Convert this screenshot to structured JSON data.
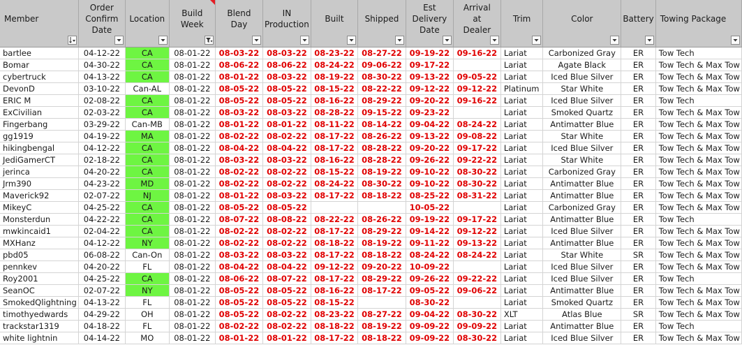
{
  "colors": {
    "header_bg": "#c9c9c9",
    "highlight_green": "#6ef542",
    "date_red": "#e00000",
    "corner_marker": "#e51c23"
  },
  "headers": [
    {
      "key": "member",
      "label": "Member",
      "filter": "sort-icon"
    },
    {
      "key": "order_confirm",
      "label": "Order\nConfirm\nDate",
      "filter": "dropdown-icon"
    },
    {
      "key": "location",
      "label": "Location",
      "filter": "dropdown-icon"
    },
    {
      "key": "build_week",
      "label": "Build\nWeek",
      "filter": "filter-applied-icon"
    },
    {
      "key": "blend_day",
      "label": "Blend\nDay",
      "filter": "dropdown-icon"
    },
    {
      "key": "in_production",
      "label": "IN\nProduction",
      "filter": "dropdown-icon"
    },
    {
      "key": "built",
      "label": "Built",
      "filter": "dropdown-icon"
    },
    {
      "key": "shipped",
      "label": "Shipped",
      "filter": "dropdown-icon"
    },
    {
      "key": "est_delivery",
      "label": "Est\nDelivery\nDate",
      "filter": "dropdown-icon"
    },
    {
      "key": "arrival",
      "label": "Arrival\nat\nDealer",
      "filter": "dropdown-icon"
    },
    {
      "key": "trim",
      "label": "Trim",
      "filter": "dropdown-icon"
    },
    {
      "key": "color",
      "label": "Color",
      "filter": "dropdown-icon"
    },
    {
      "key": "battery",
      "label": "Battery",
      "filter": "dropdown-icon"
    },
    {
      "key": "towing",
      "label": "Towing Package",
      "filter": "dropdown-icon"
    }
  ],
  "rows": [
    {
      "member": "bartlee",
      "order_confirm": "04-12-22",
      "location": "CA",
      "location_green": true,
      "build_week": "08-01-22",
      "blend_day": "08-03-22",
      "in_production": "08-03-22",
      "built": "08-23-22",
      "shipped": "08-27-22",
      "est_delivery": "09-19-22",
      "arrival": "09-16-22",
      "trim": "Lariat",
      "color": "Carbonized Gray",
      "battery": "ER",
      "towing": "Tow Tech"
    },
    {
      "member": "Bomar",
      "order_confirm": "04-30-22",
      "location": "CA",
      "location_green": true,
      "build_week": "08-01-22",
      "blend_day": "08-06-22",
      "in_production": "08-06-22",
      "built": "08-24-22",
      "shipped": "09-06-22",
      "est_delivery": "09-17-22",
      "arrival": "",
      "trim": "Lariat",
      "color": "Agate Black",
      "battery": "ER",
      "towing": "Tow Tech & Max Tow"
    },
    {
      "member": "cybertruck",
      "order_confirm": "04-13-22",
      "location": "CA",
      "location_green": true,
      "build_week": "08-01-22",
      "blend_day": "08-01-22",
      "in_production": "08-03-22",
      "built": "08-19-22",
      "shipped": "08-30-22",
      "est_delivery": "09-13-22",
      "arrival": "09-05-22",
      "trim": "Lariat",
      "color": "Iced Blue Silver",
      "battery": "ER",
      "towing": "Tow Tech & Max Tow"
    },
    {
      "member": "DevonD",
      "order_confirm": "03-10-22",
      "location": "Can-AL",
      "location_green": false,
      "build_week": "08-01-22",
      "blend_day": "08-05-22",
      "in_production": "08-05-22",
      "built": "08-15-22",
      "shipped": "08-22-22",
      "est_delivery": "09-12-22",
      "arrival": "09-12-22",
      "trim": "Platinum",
      "color": "Star White",
      "battery": "ER",
      "towing": "Tow Tech & Max Tow"
    },
    {
      "member": "ERIC M",
      "order_confirm": "02-08-22",
      "location": "CA",
      "location_green": true,
      "build_week": "08-01-22",
      "blend_day": "08-05-22",
      "in_production": "08-05-22",
      "built": "08-16-22",
      "shipped": "08-29-22",
      "est_delivery": "09-20-22",
      "arrival": "09-16-22",
      "trim": "Lariat",
      "color": "Iced Blue Silver",
      "battery": "ER",
      "towing": "Tow Tech"
    },
    {
      "member": "ExCivilian",
      "order_confirm": "02-03-22",
      "location": "CA",
      "location_green": true,
      "build_week": "08-01-22",
      "blend_day": "08-03-22",
      "in_production": "08-03-22",
      "built": "08-28-22",
      "shipped": "09-15-22",
      "est_delivery": "09-23-22",
      "arrival": "",
      "trim": "Lariat",
      "color": "Smoked Quartz",
      "battery": "ER",
      "towing": "Tow Tech & Max Tow"
    },
    {
      "member": "Fingerbang",
      "order_confirm": "03-29-22",
      "location": "Can-MB",
      "location_green": false,
      "build_week": "08-01-22",
      "blend_day": "08-01-22",
      "in_production": "08-01-22",
      "built": "08-11-22",
      "shipped": "08-14-22",
      "est_delivery": "09-04-22",
      "arrival": "08-24-22",
      "trim": "Lariat",
      "color": "Antimatter Blue",
      "battery": "ER",
      "towing": "Tow Tech & Max Tow"
    },
    {
      "member": "gg1919",
      "order_confirm": "04-19-22",
      "location": "MA",
      "location_green": true,
      "build_week": "08-01-22",
      "blend_day": "08-02-22",
      "in_production": "08-02-22",
      "built": "08-17-22",
      "shipped": "08-26-22",
      "est_delivery": "09-13-22",
      "arrival": "09-08-22",
      "trim": "Lariat",
      "color": "Star White",
      "battery": "ER",
      "towing": "Tow Tech & Max Tow"
    },
    {
      "member": "hikingbengal",
      "order_confirm": "04-12-22",
      "location": "CA",
      "location_green": true,
      "build_week": "08-01-22",
      "blend_day": "08-04-22",
      "in_production": "08-04-22",
      "built": "08-17-22",
      "shipped": "08-28-22",
      "est_delivery": "09-20-22",
      "arrival": "09-17-22",
      "trim": "Lariat",
      "color": "Iced Blue Silver",
      "battery": "ER",
      "towing": "Tow Tech & Max Tow"
    },
    {
      "member": "JediGamerCT",
      "order_confirm": "02-18-22",
      "location": "CA",
      "location_green": true,
      "build_week": "08-01-22",
      "blend_day": "08-03-22",
      "in_production": "08-03-22",
      "built": "08-16-22",
      "shipped": "08-28-22",
      "est_delivery": "09-26-22",
      "arrival": "09-22-22",
      "trim": "Lariat",
      "color": "Star White",
      "battery": "ER",
      "towing": "Tow Tech & Max Tow"
    },
    {
      "member": "jerinca",
      "order_confirm": "04-20-22",
      "location": "CA",
      "location_green": true,
      "build_week": "08-01-22",
      "blend_day": "08-02-22",
      "in_production": "08-02-22",
      "built": "08-15-22",
      "shipped": "08-19-22",
      "est_delivery": "09-10-22",
      "arrival": "08-30-22",
      "trim": "Lariat",
      "color": "Carbonized Gray",
      "battery": "ER",
      "towing": "Tow Tech & Max Tow"
    },
    {
      "member": "Jrm390",
      "order_confirm": "04-23-22",
      "location": "MD",
      "location_green": true,
      "build_week": "08-01-22",
      "blend_day": "08-02-22",
      "in_production": "08-02-22",
      "built": "08-24-22",
      "shipped": "08-30-22",
      "est_delivery": "09-10-22",
      "arrival": "08-30-22",
      "trim": "Lariat",
      "color": "Antimatter Blue",
      "battery": "ER",
      "towing": "Tow Tech & Max Tow"
    },
    {
      "member": "Maverick92",
      "order_confirm": "02-07-22",
      "location": "NJ",
      "location_green": true,
      "build_week": "08-01-22",
      "blend_day": "08-01-22",
      "in_production": "08-03-22",
      "built": "08-17-22",
      "shipped": "08-18-22",
      "est_delivery": "08-25-22",
      "arrival": "08-31-22",
      "trim": "Lariat",
      "color": "Antimatter Blue",
      "battery": "ER",
      "towing": "Tow Tech & Max Tow"
    },
    {
      "member": "MikeyC",
      "order_confirm": "04-25-22",
      "location": "CA",
      "location_green": true,
      "build_week": "08-01-22",
      "blend_day": "08-05-22",
      "in_production": "08-05-22",
      "built": "",
      "shipped": "",
      "est_delivery": "10-05-22",
      "arrival": "",
      "trim": "Lariat",
      "color": "Carbonized Gray",
      "battery": "ER",
      "towing": "Tow Tech & Max Tow"
    },
    {
      "member": "Monsterdun",
      "order_confirm": "04-22-22",
      "location": "CA",
      "location_green": true,
      "build_week": "08-01-22",
      "blend_day": "08-07-22",
      "in_production": "08-08-22",
      "built": "08-22-22",
      "shipped": "08-26-22",
      "est_delivery": "09-19-22",
      "arrival": "09-17-22",
      "trim": "Lariat",
      "color": "Antimatter Blue",
      "battery": "ER",
      "towing": "Tow Tech"
    },
    {
      "member": "mwkincaid1",
      "order_confirm": "02-04-22",
      "location": "CA",
      "location_green": true,
      "build_week": "08-01-22",
      "blend_day": "08-02-22",
      "in_production": "08-02-22",
      "built": "08-17-22",
      "shipped": "08-29-22",
      "est_delivery": "09-14-22",
      "arrival": "09-12-22",
      "trim": "Lariat",
      "color": "Iced Blue Silver",
      "battery": "ER",
      "towing": "Tow Tech & Max Tow"
    },
    {
      "member": "MXHanz",
      "order_confirm": "04-12-22",
      "location": "NY",
      "location_green": true,
      "build_week": "08-01-22",
      "blend_day": "08-02-22",
      "in_production": "08-02-22",
      "built": "08-18-22",
      "shipped": "08-19-22",
      "est_delivery": "09-11-22",
      "arrival": "09-13-22",
      "trim": "Lariat",
      "color": "Antimatter Blue",
      "battery": "ER",
      "towing": "Tow Tech & Max Tow"
    },
    {
      "member": "pbd05",
      "order_confirm": "06-08-22",
      "location": "Can-On",
      "location_green": false,
      "build_week": "08-01-22",
      "blend_day": "08-03-22",
      "in_production": "08-03-22",
      "built": "08-17-22",
      "shipped": "08-18-22",
      "est_delivery": "08-24-22",
      "arrival": "08-24-22",
      "trim": "Lariat",
      "color": "Star White",
      "battery": "SR",
      "towing": "Tow Tech & Max Tow"
    },
    {
      "member": "pennkev",
      "order_confirm": "04-20-22",
      "location": "FL",
      "location_green": false,
      "build_week": "08-01-22",
      "blend_day": "08-04-22",
      "in_production": "08-04-22",
      "built": "09-12-22",
      "shipped": "09-20-22",
      "est_delivery": "10-09-22",
      "arrival": "",
      "trim": "Lariat",
      "color": "Iced Blue Silver",
      "battery": "ER",
      "towing": "Tow Tech & Max Tow"
    },
    {
      "member": "Roy2001",
      "order_confirm": "04-25-22",
      "location": "CA",
      "location_green": true,
      "build_week": "08-01-22",
      "blend_day": "08-06-22",
      "in_production": "08-07-22",
      "built": "08-17-22",
      "shipped": "08-29-22",
      "est_delivery": "09-26-22",
      "arrival": "09-22-22",
      "trim": "Lariat",
      "color": "Iced Blue Silver",
      "battery": "ER",
      "towing": "Tow Tech"
    },
    {
      "member": "SeanOC",
      "order_confirm": "02-07-22",
      "location": "NY",
      "location_green": true,
      "build_week": "08-01-22",
      "blend_day": "08-05-22",
      "in_production": "08-05-22",
      "built": "08-16-22",
      "shipped": "08-17-22",
      "est_delivery": "09-05-22",
      "arrival": "09-06-22",
      "trim": "Lariat",
      "color": "Antimatter Blue",
      "battery": "ER",
      "towing": "Tow Tech & Max Tow"
    },
    {
      "member": "SmokedQlightning",
      "order_confirm": "04-13-22",
      "location": "FL",
      "location_green": false,
      "build_week": "08-01-22",
      "blend_day": "08-05-22",
      "in_production": "08-05-22",
      "built": "08-15-22",
      "shipped": "",
      "est_delivery": "08-30-22",
      "arrival": "",
      "trim": "Lariat",
      "color": "Smoked Quartz",
      "battery": "ER",
      "towing": "Tow Tech & Max Tow"
    },
    {
      "member": "timothyedwards",
      "order_confirm": "04-29-22",
      "location": "OH",
      "location_green": false,
      "build_week": "08-01-22",
      "blend_day": "08-05-22",
      "in_production": "08-02-22",
      "built": "08-23-22",
      "shipped": "08-27-22",
      "est_delivery": "09-04-22",
      "arrival": "08-30-22",
      "trim": "XLT",
      "color": "Atlas Blue",
      "battery": "SR",
      "towing": "Tow Tech & Max Tow"
    },
    {
      "member": "trackstar1319",
      "order_confirm": "04-18-22",
      "location": "FL",
      "location_green": false,
      "build_week": "08-01-22",
      "blend_day": "08-02-22",
      "in_production": "08-02-22",
      "built": "08-18-22",
      "shipped": "08-19-22",
      "est_delivery": "09-09-22",
      "arrival": "09-09-22",
      "trim": "Lariat",
      "color": "Antimatter Blue",
      "battery": "ER",
      "towing": "Tow Tech"
    },
    {
      "member": "white lightnin",
      "order_confirm": "04-14-22",
      "location": "MO",
      "location_green": false,
      "build_week": "08-01-22",
      "blend_day": "08-01-22",
      "in_production": "08-01-22",
      "built": "08-17-22",
      "shipped": "08-18-22",
      "est_delivery": "09-09-22",
      "arrival": "08-30-22",
      "trim": "Lariat",
      "color": "Iced Blue Silver",
      "battery": "ER",
      "towing": "Tow Tech & Max Tow"
    }
  ]
}
